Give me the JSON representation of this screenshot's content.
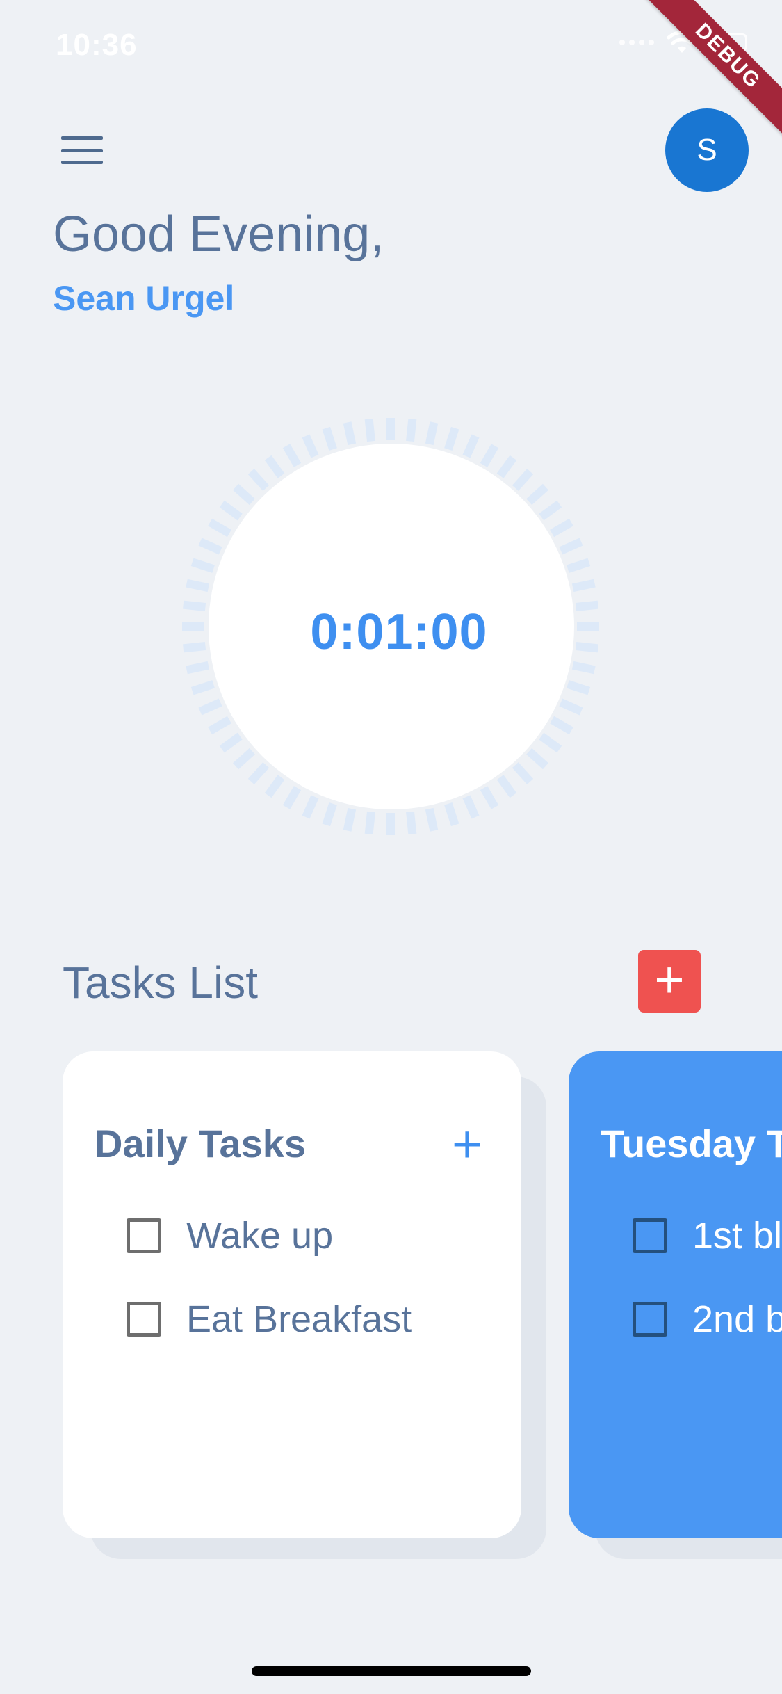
{
  "status_bar": {
    "time": "10:36",
    "icons": [
      "signal-icon",
      "wifi-icon",
      "battery-icon"
    ]
  },
  "debug_banner": "DEBUG",
  "header": {
    "menu_icon": "hamburger-menu-icon",
    "avatar_initial": "S"
  },
  "greeting": {
    "salutation": "Good Evening,",
    "name": "Sean Urgel"
  },
  "timer": {
    "display": "0:01:00"
  },
  "tasks_section": {
    "title": "Tasks List",
    "add_button_label": "+"
  },
  "task_lists": [
    {
      "title": "Daily Tasks",
      "add_label": "+",
      "items": [
        {
          "label": "Wake up",
          "checked": false
        },
        {
          "label": "Eat Breakfast",
          "checked": false
        }
      ]
    },
    {
      "title": "Tuesday T",
      "items": [
        {
          "label": "1st bl",
          "checked": false
        },
        {
          "label": "2nd b",
          "checked": false
        }
      ]
    }
  ],
  "colors": {
    "background": "#EEF1F5",
    "primary_blue": "#4A97F3",
    "text_slate": "#58739A",
    "avatar_blue": "#1976D2",
    "add_red": "#EF5250",
    "debug_red": "#A3263A"
  }
}
